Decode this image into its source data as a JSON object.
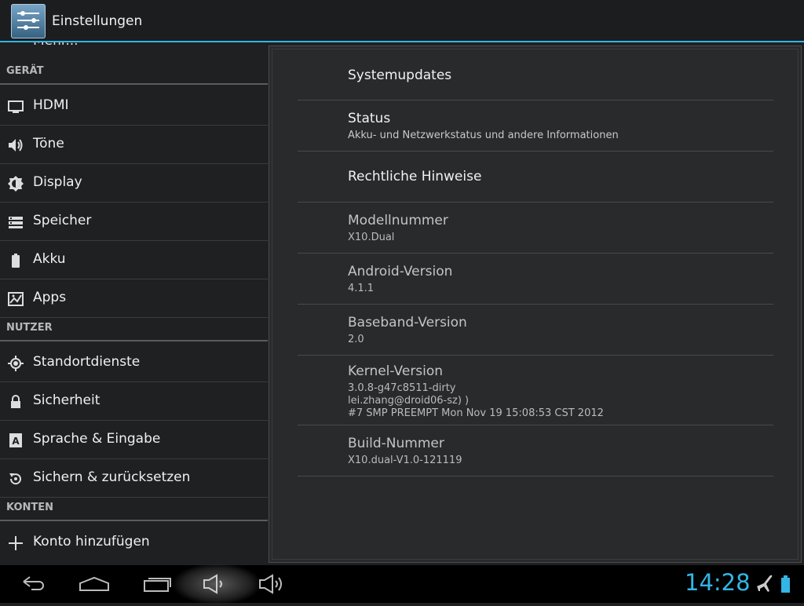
{
  "action_bar": {
    "title": "Einstellungen"
  },
  "left": {
    "cut_item": "Mehr...",
    "sections": {
      "geraet": "GERÄT",
      "nutzer": "NUTZER",
      "konten": "KONTEN"
    },
    "items": {
      "hdmi": "HDMI",
      "toene": "Töne",
      "display": "Display",
      "speicher": "Speicher",
      "akku": "Akku",
      "apps": "Apps",
      "standort": "Standortdienste",
      "sicherheit": "Sicherheit",
      "sprache": "Sprache & Eingabe",
      "sichern": "Sichern & zurücksetzen",
      "konto": "Konto hinzufügen"
    }
  },
  "right": {
    "systemupdates": {
      "title": "Systemupdates"
    },
    "status": {
      "title": "Status",
      "summary": "Akku- und Netzwerkstatus und andere Informationen"
    },
    "rechtliche": {
      "title": "Rechtliche Hinweise"
    },
    "modell": {
      "title": "Modellnummer",
      "value": "X10.Dual"
    },
    "android": {
      "title": "Android-Version",
      "value": "4.1.1"
    },
    "baseband": {
      "title": "Baseband-Version",
      "value": "2.0"
    },
    "kernel": {
      "title": "Kernel-Version",
      "line1": "3.0.8-g47c8511-dirty",
      "line2": "lei.zhang@droid06-sz) )",
      "line3": "#7 SMP PREEMPT Mon Nov 19 15:08:53 CST 2012"
    },
    "build": {
      "title": "Build-Nummer",
      "value": "X10.dual-V1.0-121119"
    }
  },
  "status_bar": {
    "time": "14:28"
  },
  "colors": {
    "accent": "#33b5e5",
    "background": "#1e2022",
    "panel": "#282a2c"
  }
}
